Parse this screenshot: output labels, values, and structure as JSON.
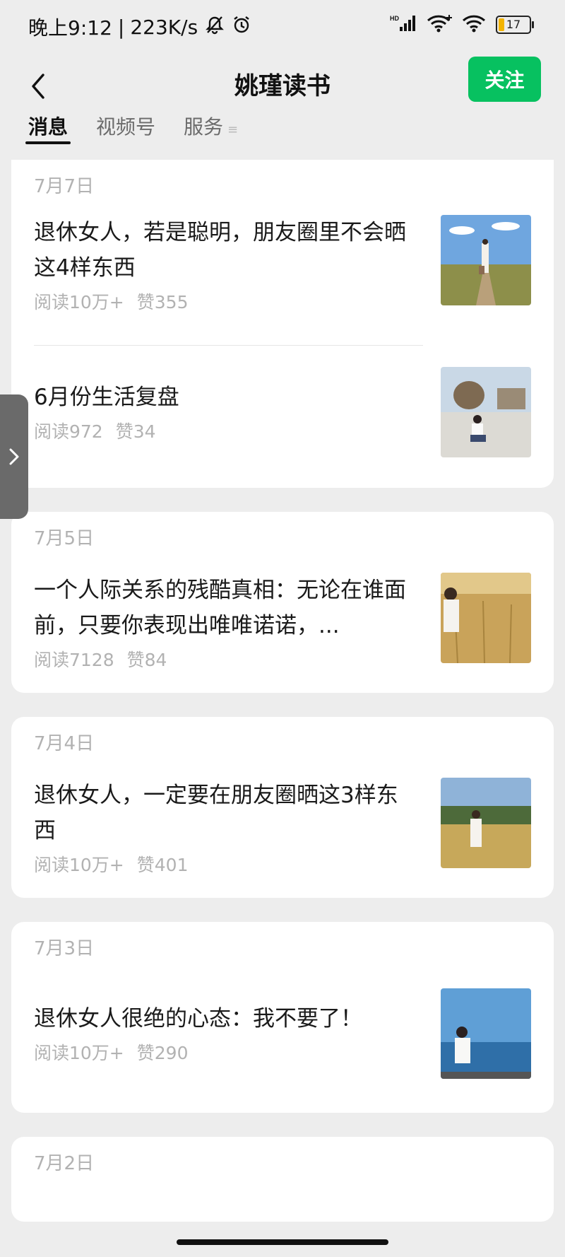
{
  "status": {
    "time": "晚上9:12",
    "speed": "223K/s",
    "battery": "17"
  },
  "header": {
    "title": "姚瑾读书",
    "follow": "关注"
  },
  "tabs": [
    "消息",
    "视频号",
    "服务"
  ],
  "groups": [
    {
      "date": "7月7日",
      "articles": [
        {
          "title": "退休女人，若是聪明，朋友圈里不会晒这4样东西",
          "reads": "阅读10万+",
          "likes": "赞355"
        },
        {
          "title": "6月份生活复盘",
          "reads": "阅读972",
          "likes": "赞34"
        }
      ]
    },
    {
      "date": "7月5日",
      "articles": [
        {
          "title": "一个人际关系的残酷真相：无论在谁面前，只要你表现出唯唯诺诺，...",
          "reads": "阅读7128",
          "likes": "赞84"
        }
      ]
    },
    {
      "date": "7月4日",
      "articles": [
        {
          "title": "退休女人，一定要在朋友圈晒这3样东西",
          "reads": "阅读10万+",
          "likes": "赞401"
        }
      ]
    },
    {
      "date": "7月3日",
      "articles": [
        {
          "title": "退休女人很绝的心态：我不要了！",
          "reads": "阅读10万+",
          "likes": "赞290"
        }
      ]
    },
    {
      "date": "7月2日",
      "articles": []
    }
  ],
  "icons": {
    "back": "back-arrow-icon",
    "bell_off": "bell-off-icon",
    "alarm": "alarm-icon",
    "signal": "signal-icon",
    "wifi": "wifi-icon",
    "battery": "battery-icon",
    "side_tab": "chevron-right-icon",
    "tab_more": "menu-lines-icon"
  },
  "colors": {
    "accent": "#07c160",
    "background": "#ededed",
    "card": "#ffffff",
    "meta": "#b2b2b2"
  }
}
